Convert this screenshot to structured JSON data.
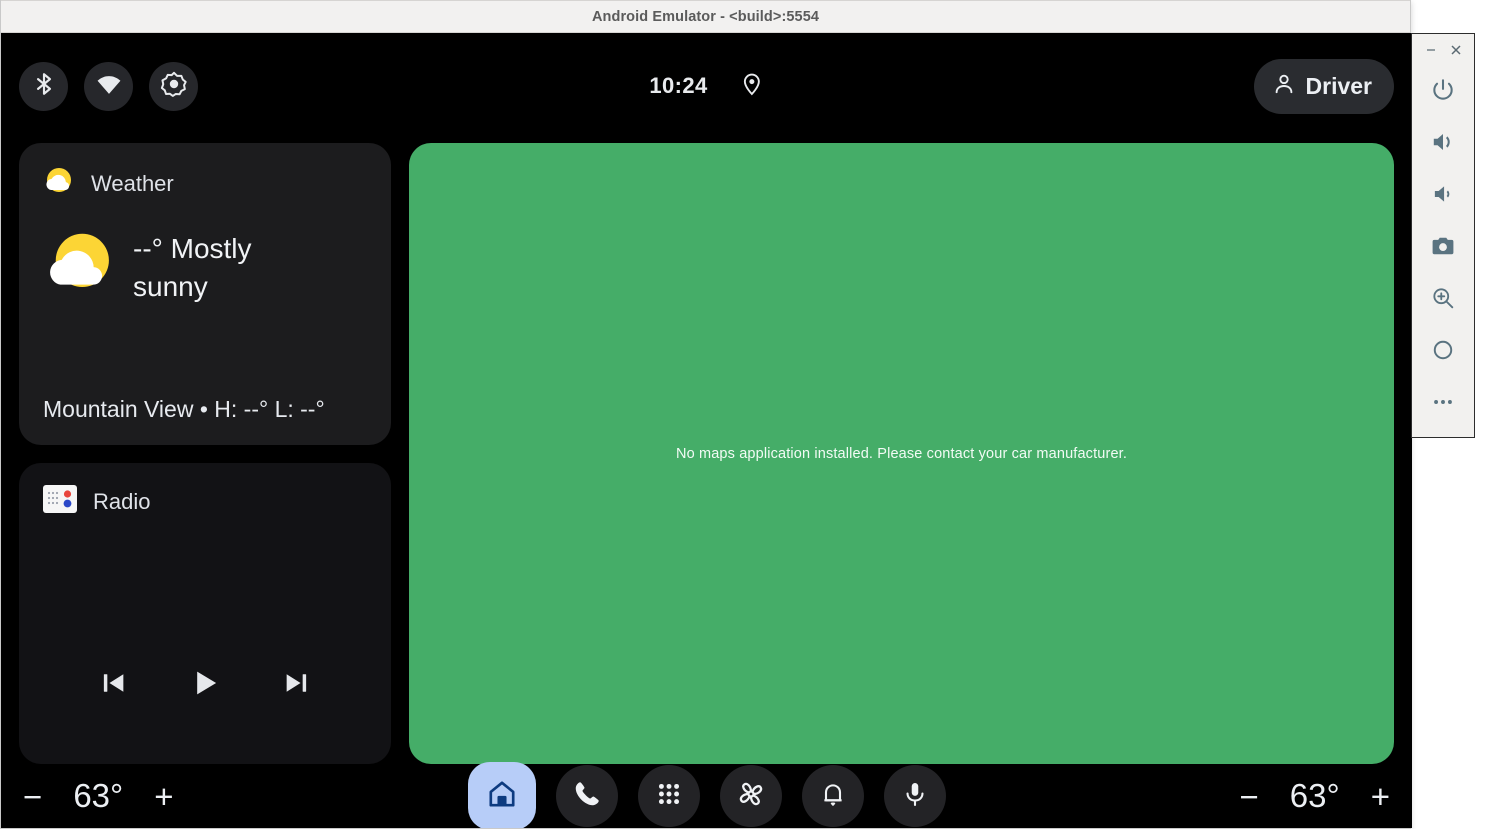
{
  "window": {
    "title": "Android Emulator - <build>:5554",
    "minimize_label": "–",
    "close_label": "×"
  },
  "statusbar": {
    "icons": [
      {
        "name": "bluetooth-icon",
        "label": "Bluetooth"
      },
      {
        "name": "wifi-icon",
        "label": "Wi-Fi"
      },
      {
        "name": "brightness-icon",
        "label": "Display brightness"
      }
    ],
    "clock": "10:24",
    "location_icon": "location-pin-icon",
    "user": {
      "label": "Driver",
      "icon": "user-avatar-icon"
    }
  },
  "widgets": {
    "weather": {
      "title": "Weather",
      "icon": "partly-cloudy-icon",
      "condition": "--° Mostly sunny",
      "location_line": "Mountain View • H: --° L: --°"
    },
    "radio": {
      "title": "Radio",
      "icon": "radio-tuner-icon",
      "controls": [
        {
          "name": "skip-previous-button",
          "label": "Previous"
        },
        {
          "name": "play-button",
          "label": "Play"
        },
        {
          "name": "skip-next-button",
          "label": "Next"
        }
      ]
    }
  },
  "map": {
    "message": "No maps application installed. Please contact your car manufacturer.",
    "background_color": "#45ad68"
  },
  "navbar": {
    "temp_left": {
      "decrease_label": "−",
      "value": "63°",
      "increase_label": "+"
    },
    "temp_right": {
      "decrease_label": "−",
      "value": "63°",
      "increase_label": "+"
    },
    "buttons": [
      {
        "name": "nav-home-button",
        "label": "Home",
        "icon": "home-icon",
        "active": true
      },
      {
        "name": "nav-dialer-button",
        "label": "Phone",
        "icon": "phone-icon",
        "active": false
      },
      {
        "name": "nav-apps-button",
        "label": "App grid",
        "icon": "apps-grid-icon",
        "active": false
      },
      {
        "name": "nav-climate-button",
        "label": "Climate",
        "icon": "fan-icon",
        "active": false
      },
      {
        "name": "nav-notifications-button",
        "label": "Notifications",
        "icon": "bell-icon",
        "active": false
      },
      {
        "name": "nav-assistant-button",
        "label": "Assistant",
        "icon": "microphone-icon",
        "active": false
      }
    ]
  },
  "emulator_toolbar": {
    "buttons": [
      {
        "name": "power-button",
        "label": "Power",
        "icon": "power-icon"
      },
      {
        "name": "volume-up-button",
        "label": "Volume up",
        "icon": "volume-up-icon"
      },
      {
        "name": "volume-down-button",
        "label": "Volume down",
        "icon": "volume-down-icon"
      },
      {
        "name": "screenshot-button",
        "label": "Take screenshot",
        "icon": "camera-icon"
      },
      {
        "name": "zoom-button",
        "label": "Zoom",
        "icon": "magnifier-plus-icon"
      },
      {
        "name": "rotate-button",
        "label": "Rotate",
        "icon": "circle-icon"
      },
      {
        "name": "more-button",
        "label": "More",
        "icon": "ellipsis-icon"
      }
    ]
  },
  "colors": {
    "accent_blue": "#b7cdf8",
    "home_icon_navy": "#0d3b80",
    "map_green": "#45ad68",
    "card_dark": "#1c1c1e",
    "weather_yellow": "#fcd535"
  }
}
